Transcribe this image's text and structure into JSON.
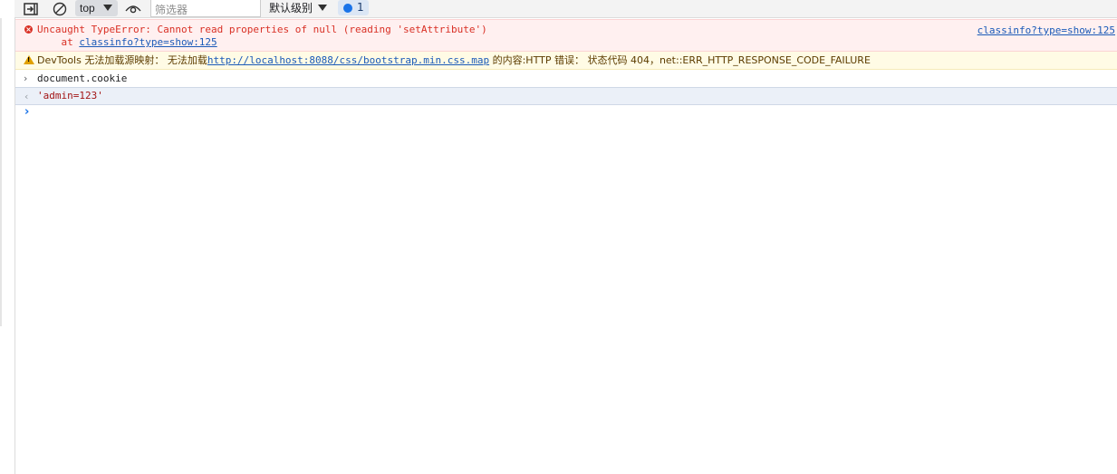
{
  "toolbar": {
    "context": "top",
    "filter_placeholder": "筛选器",
    "levels": "默认级别",
    "issues_count": "1"
  },
  "console": {
    "error": {
      "message": "Uncaught TypeError: Cannot read properties of null (reading 'setAttribute')",
      "at_prefix": "    at ",
      "at_link": "classinfo?type=show:125",
      "source_link": "classinfo?type=show:125"
    },
    "warning": {
      "prefix": "DevTools 无法加载源映射： 无法加载",
      "url": "http://localhost:8088/css/bootstrap.min.css.map",
      "suffix": " 的内容:HTTP 错误： 状态代码 404，net::ERR_HTTP_RESPONSE_CODE_FAILURE"
    },
    "input": "document.cookie",
    "output": "'admin=123'"
  },
  "icons": {
    "dock": "dock-side-icon",
    "clear": "clear-console-icon",
    "eye": "live-expression-eye-icon",
    "issues": "issues-chat-icon",
    "error": "error-icon",
    "warning": "warning-icon"
  },
  "colors": {
    "error": "#d93025",
    "warning_bg": "#fffbe5",
    "link": "#1a5ab8",
    "prompt": "#1a73e8"
  }
}
